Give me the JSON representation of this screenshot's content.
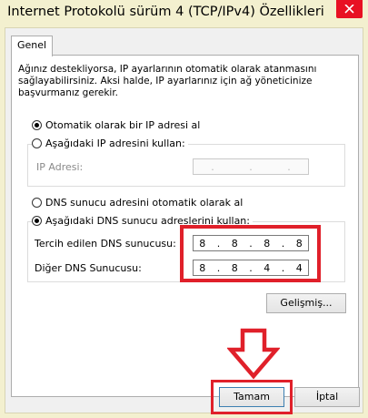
{
  "window": {
    "title": "Internet Protokolü sürüm 4 (TCP/IPv4) Özellikleri"
  },
  "tabs": [
    {
      "label": "Genel"
    }
  ],
  "description": "Ağınız destekliyorsa, IP ayarlarının otomatik olarak atanmasını sağlayabilirsiniz. Aksi halde, IP ayarlarınız için ağ yöneticinize başvurmanız gerekir.",
  "ip_section": {
    "auto_label": "Otomatik olarak bir IP adresi al",
    "auto_selected": true,
    "manual_label": "Aşağıdaki IP adresini kullan:",
    "manual_selected": false,
    "ip_address_label": "IP Adresi:",
    "ip_address_value": [
      ".",
      ".",
      "."
    ]
  },
  "dns_section": {
    "auto_label": "DNS sunucu adresini otomatik olarak al",
    "auto_selected": false,
    "manual_label": "Aşağıdaki DNS sunucu adreslerini kullan:",
    "manual_selected": true,
    "preferred_label": "Tercih edilen DNS sunucusu:",
    "preferred_value": [
      "8",
      ".",
      "8",
      ".",
      "8",
      ".",
      "8"
    ],
    "alternate_label": "Diğer DNS Sunucusu:",
    "alternate_value": [
      "8",
      ".",
      "8",
      ".",
      "4",
      ".",
      "4"
    ]
  },
  "buttons": {
    "advanced": "Gelişmiş...",
    "ok": "Tamam",
    "cancel": "İptal"
  },
  "colors": {
    "title_bg": "#f3f0cf",
    "close_red": "#e81123",
    "highlight_red": "#e0202a"
  }
}
